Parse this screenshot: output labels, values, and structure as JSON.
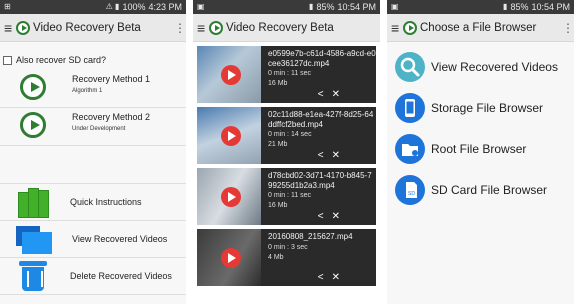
{
  "screen1": {
    "status": {
      "left": "⊞",
      "icons": "⚠ ▮",
      "battery": "100%",
      "time": "4:23 PM"
    },
    "appbar": {
      "title": "Video Recovery Beta"
    },
    "checkbox_label": "Also recover SD card?",
    "methods": [
      {
        "title": "Recovery Method 1",
        "subtitle": "Algorithm 1"
      },
      {
        "title": "Recovery Method 2",
        "subtitle": "Under Development"
      }
    ],
    "actions": [
      {
        "label": "Quick Instructions",
        "icon": "books-icon"
      },
      {
        "label": "View Recovered Videos",
        "icon": "folder-icon"
      },
      {
        "label": "Delete Recovered Videos",
        "icon": "trash-icon"
      }
    ]
  },
  "screen2": {
    "status": {
      "left": "▣",
      "battery": "85%",
      "time": "10:54 PM"
    },
    "appbar": {
      "title": "Video Recovery Beta"
    },
    "videos": [
      {
        "name": "e0599e7b-c61d-4586-a9cd-e0cee36127dc.mp4",
        "duration": "0 min : 11 sec",
        "size": "16 Mb"
      },
      {
        "name": "02c11d88-e1ea-427f-8d25-64ddffcf2bed.mp4",
        "duration": "0 min : 14 sec",
        "size": "21 Mb"
      },
      {
        "name": "d78cbd02-3d71-4170-b845-799255d1b2a3.mp4",
        "duration": "0 min : 11 sec",
        "size": "16 Mb"
      },
      {
        "name": "20160808_215627.mp4",
        "duration": "0 min : 3 sec",
        "size": "4 Mb"
      }
    ]
  },
  "screen3": {
    "status": {
      "left": "▣",
      "battery": "85%",
      "time": "10:54 PM"
    },
    "appbar": {
      "title": "Choose a File Browser"
    },
    "items": [
      {
        "label": "View Recovered Videos",
        "icon": "magnifier-icon",
        "color": "#4fb3c8"
      },
      {
        "label": "Storage File Browser",
        "icon": "phone-icon",
        "color": "#1e74d8"
      },
      {
        "label": "Root File Browser",
        "icon": "folder-icon",
        "color": "#1e74d8"
      },
      {
        "label": "SD Card File Browser",
        "icon": "sdcard-icon",
        "color": "#1e74d8"
      }
    ]
  }
}
